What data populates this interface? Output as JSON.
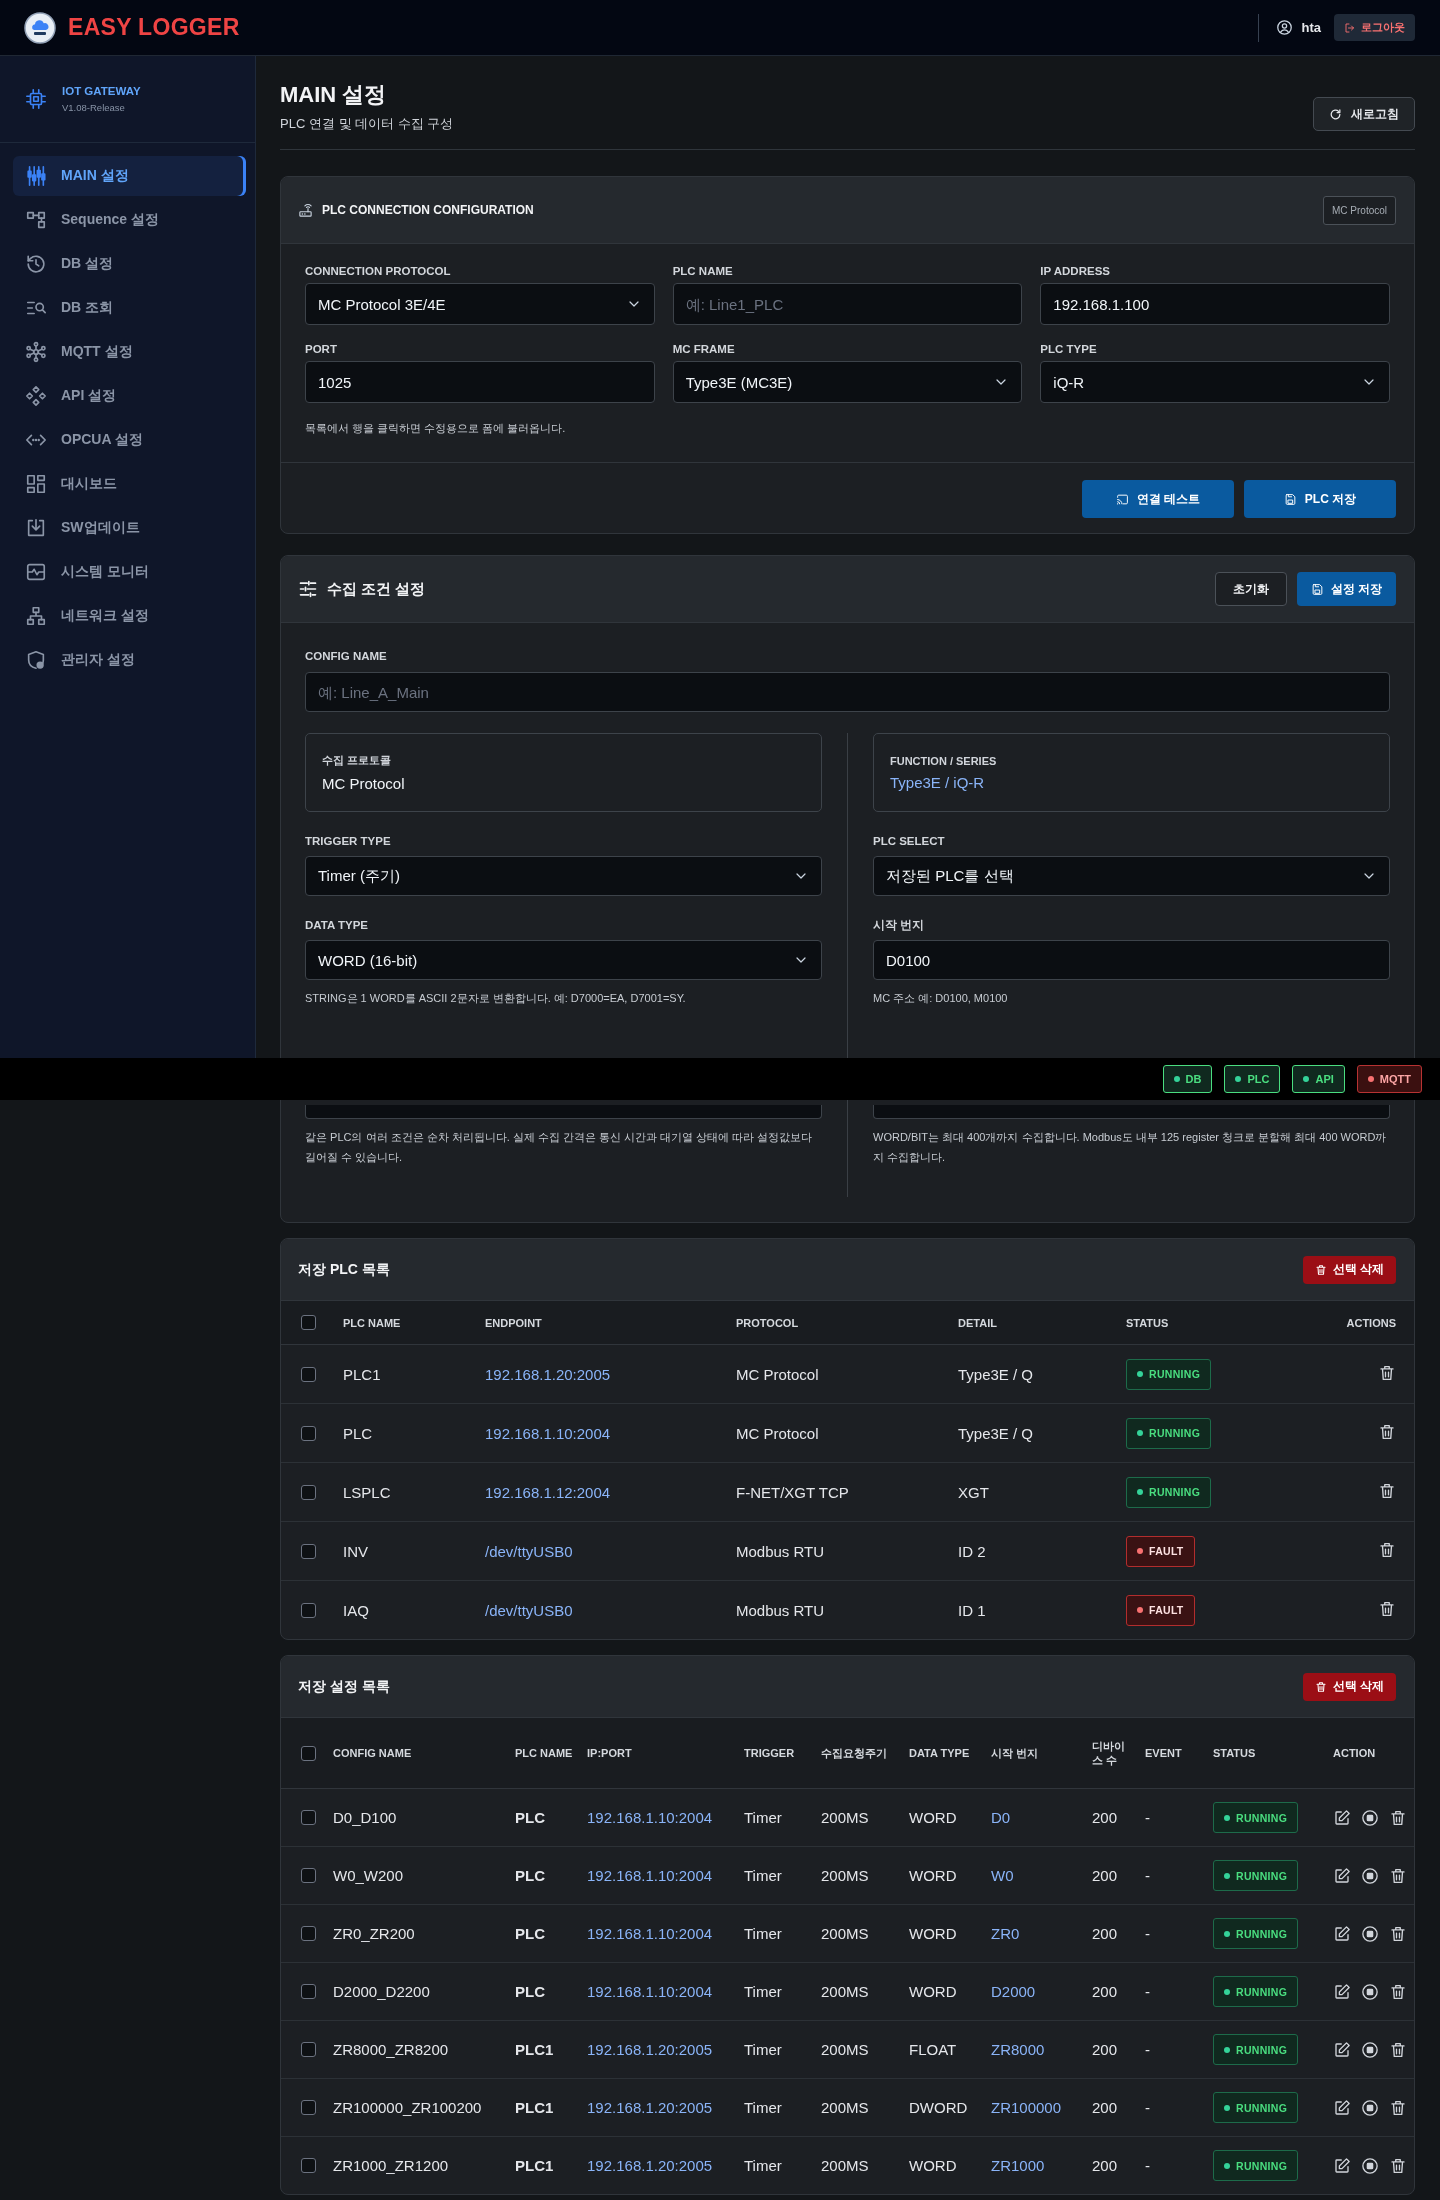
{
  "header": {
    "app_name": "EASY LOGGER",
    "user": "hta",
    "logout": "로그아웃"
  },
  "sidebar": {
    "product": "IOT GATEWAY",
    "version": "V1.08-Release",
    "items": [
      {
        "label": "MAIN 설정",
        "selected": true
      },
      {
        "label": "Sequence 설정",
        "selected": false
      },
      {
        "label": "DB 설정",
        "selected": false
      },
      {
        "label": "DB 조회",
        "selected": false
      },
      {
        "label": "MQTT 설정",
        "selected": false
      },
      {
        "label": "API 설정",
        "selected": false
      },
      {
        "label": "OPCUA 설정",
        "selected": false
      },
      {
        "label": "대시보드",
        "selected": false
      },
      {
        "label": "SW업데이트",
        "selected": false
      },
      {
        "label": "시스템 모니터",
        "selected": false
      },
      {
        "label": "네트워크 설정",
        "selected": false
      },
      {
        "label": "관리자 설정",
        "selected": false
      }
    ]
  },
  "page": {
    "title": "MAIN 설정",
    "subtitle": "PLC 연결 및 데이터 수집 구성",
    "refresh_button": "새로고침"
  },
  "plc_connection": {
    "title": "PLC CONNECTION CONFIGURATION",
    "badge": "MC Protocol",
    "fields": [
      {
        "label": "CONNECTION PROTOCOL",
        "kind": "select",
        "value": "MC Protocol 3E/4E"
      },
      {
        "label": "PLC NAME",
        "kind": "input",
        "placeholder": "예: Line1_PLC"
      },
      {
        "label": "IP ADDRESS",
        "kind": "input",
        "value": "192.168.1.100"
      },
      {
        "label": "PORT",
        "kind": "input",
        "value": "1025"
      },
      {
        "label": "MC FRAME",
        "kind": "select",
        "value": "Type3E (MC3E)"
      },
      {
        "label": "PLC TYPE",
        "kind": "select",
        "value": "iQ-R"
      }
    ],
    "hint": "목록에서 행을 클릭하면 수정용으로 폼에 불러옵니다.",
    "buttons": [
      "연결 테스트",
      "PLC 저장"
    ]
  },
  "collection": {
    "title": "수집 조건 설정",
    "buttons": [
      {
        "label": "초기화",
        "kind": "outline"
      },
      {
        "label": "설정 저장",
        "kind": "primary"
      }
    ],
    "config_name": {
      "label": "CONFIG NAME",
      "placeholder": "예: Line_A_Main"
    },
    "columns": [
      {
        "info": {
          "label": "수집 프로토콜",
          "value": "MC Protocol",
          "accent": false
        },
        "fields": [
          {
            "label": "TRIGGER TYPE",
            "kind": "select",
            "value": "Timer (주기)"
          },
          {
            "label": "DATA TYPE",
            "kind": "select",
            "value": "WORD (16-bit)",
            "hint": "STRING은 1 WORD를 ASCII 2문자로 변환합니다. 예: D7000=EA, D7001=SY."
          },
          {
            "kind": "input",
            "hint": "같은 PLC의 여러 조건은 순차 처리됩니다. 실제 수집 간격은 통신 시간과 대기열 상태에 따라 설정값보다 길어질 수 있습니다."
          }
        ]
      },
      {
        "info": {
          "label": "FUNCTION / SERIES",
          "value": "Type3E / iQ-R",
          "accent": true
        },
        "fields": [
          {
            "label": "PLC SELECT",
            "kind": "select",
            "value": "저장된 PLC를 선택"
          },
          {
            "label": "시작 번지",
            "kind": "input",
            "value": "D0100",
            "hint": "MC 주소 예: D0100, M0100"
          },
          {
            "kind": "input",
            "hint": "WORD/BIT는 최대 400개까지 수집합니다. Modbus도 내부 125 register 청크로 분할해 최대 400 WORD까지 수집합니다."
          }
        ]
      }
    ]
  },
  "plc_list": {
    "title": "저장 PLC 목록",
    "delete_button": "선택 삭제",
    "all_checked": false,
    "columns": [
      "PLC NAME",
      "ENDPOINT",
      "PROTOCOL",
      "DETAIL",
      "STATUS",
      "ACTIONS"
    ],
    "rows": [
      {
        "checked": false,
        "name": "PLC1",
        "endpoint": "192.168.1.20:2005",
        "protocol": "MC Protocol",
        "detail": "Type3E / Q",
        "status": {
          "label": "RUNNING",
          "kind": "ok"
        }
      },
      {
        "checked": false,
        "name": "PLC",
        "endpoint": "192.168.1.10:2004",
        "protocol": "MC Protocol",
        "detail": "Type3E / Q",
        "status": {
          "label": "RUNNING",
          "kind": "ok"
        }
      },
      {
        "checked": false,
        "name": "LSPLC",
        "endpoint": "192.168.1.12:2004",
        "protocol": "F-NET/XGT TCP",
        "detail": "XGT",
        "status": {
          "label": "RUNNING",
          "kind": "ok"
        }
      },
      {
        "checked": false,
        "name": "INV",
        "endpoint": "/dev/ttyUSB0",
        "protocol": "Modbus RTU",
        "detail": "ID 2",
        "status": {
          "label": "FAULT",
          "kind": "fault"
        }
      },
      {
        "checked": false,
        "name": "IAQ",
        "endpoint": "/dev/ttyUSB0",
        "protocol": "Modbus RTU",
        "detail": "ID 1",
        "status": {
          "label": "FAULT",
          "kind": "fault"
        }
      }
    ]
  },
  "config_list": {
    "title": "저장 설정 목록",
    "delete_button": "선택 삭제",
    "all_checked": false,
    "columns": [
      "CONFIG NAME",
      "PLC NAME",
      "IP:PORT",
      "TRIGGER",
      "수집요청주기",
      "DATA TYPE",
      "시작 번지",
      "디바이스 수",
      "EVENT",
      "STATUS",
      "ACTION"
    ],
    "rows": [
      {
        "checked": false,
        "config_name": "D0_D100",
        "plc_name": "PLC",
        "ip_port": "192.168.1.10:2004",
        "trigger": "Timer",
        "interval": "200MS",
        "data_type": "WORD",
        "start_address": "D0",
        "device_count": "200",
        "event": "-",
        "status": {
          "label": "RUNNING",
          "kind": "ok"
        }
      },
      {
        "checked": false,
        "config_name": "W0_W200",
        "plc_name": "PLC",
        "ip_port": "192.168.1.10:2004",
        "trigger": "Timer",
        "interval": "200MS",
        "data_type": "WORD",
        "start_address": "W0",
        "device_count": "200",
        "event": "-",
        "status": {
          "label": "RUNNING",
          "kind": "ok"
        }
      },
      {
        "checked": false,
        "config_name": "ZR0_ZR200",
        "plc_name": "PLC",
        "ip_port": "192.168.1.10:2004",
        "trigger": "Timer",
        "interval": "200MS",
        "data_type": "WORD",
        "start_address": "ZR0",
        "device_count": "200",
        "event": "-",
        "status": {
          "label": "RUNNING",
          "kind": "ok"
        }
      },
      {
        "checked": false,
        "config_name": "D2000_D2200",
        "plc_name": "PLC",
        "ip_port": "192.168.1.10:2004",
        "trigger": "Timer",
        "interval": "200MS",
        "data_type": "WORD",
        "start_address": "D2000",
        "device_count": "200",
        "event": "-",
        "status": {
          "label": "RUNNING",
          "kind": "ok"
        }
      },
      {
        "checked": false,
        "config_name": "ZR8000_ZR8200",
        "plc_name": "PLC1",
        "ip_port": "192.168.1.20:2005",
        "trigger": "Timer",
        "interval": "200MS",
        "data_type": "FLOAT",
        "start_address": "ZR8000",
        "device_count": "200",
        "event": "-",
        "status": {
          "label": "RUNNING",
          "kind": "ok"
        }
      },
      {
        "checked": false,
        "config_name": "ZR100000_ZR100200",
        "plc_name": "PLC1",
        "ip_port": "192.168.1.20:2005",
        "trigger": "Timer",
        "interval": "200MS",
        "data_type": "DWORD",
        "start_address": "ZR100000",
        "device_count": "200",
        "event": "-",
        "status": {
          "label": "RUNNING",
          "kind": "ok"
        }
      },
      {
        "checked": false,
        "config_name": "ZR1000_ZR1200",
        "plc_name": "PLC1",
        "ip_port": "192.168.1.20:2005",
        "trigger": "Timer",
        "interval": "200MS",
        "data_type": "WORD",
        "start_address": "ZR1000",
        "device_count": "200",
        "event": "-",
        "status": {
          "label": "RUNNING",
          "kind": "ok"
        }
      }
    ]
  },
  "status_bar": [
    {
      "label": "DB",
      "kind": "ok"
    },
    {
      "label": "PLC",
      "kind": "ok"
    },
    {
      "label": "API",
      "kind": "ok"
    },
    {
      "label": "MQTT",
      "kind": "error"
    }
  ]
}
